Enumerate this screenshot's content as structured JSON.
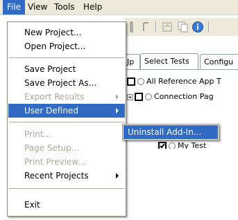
{
  "menubar": {
    "items": [
      {
        "label": "File"
      },
      {
        "label": "View"
      },
      {
        "label": "Tools"
      },
      {
        "label": "Help"
      }
    ]
  },
  "background": {
    "tabs": [
      {
        "label": "Jp"
      },
      {
        "label": "Select Tests"
      },
      {
        "label": "Configu"
      }
    ],
    "tree": [
      {
        "label": "All Reference App T"
      },
      {
        "label": "Connection Pag"
      },
      {
        "label": "My Test"
      }
    ]
  },
  "file_menu": {
    "items": [
      {
        "label": "New Project..."
      },
      {
        "label": "Open Project..."
      },
      {
        "label": "Save Project"
      },
      {
        "label": "Save Project As..."
      },
      {
        "label": "Export Results"
      },
      {
        "label": "User Defined"
      },
      {
        "label": "Print..."
      },
      {
        "label": "Page Setup..."
      },
      {
        "label": "Print Preview..."
      },
      {
        "label": "Recent Projects"
      },
      {
        "label": "Exit"
      }
    ]
  },
  "submenu": {
    "items": [
      {
        "label": "Uninstall Add-In..."
      }
    ]
  }
}
